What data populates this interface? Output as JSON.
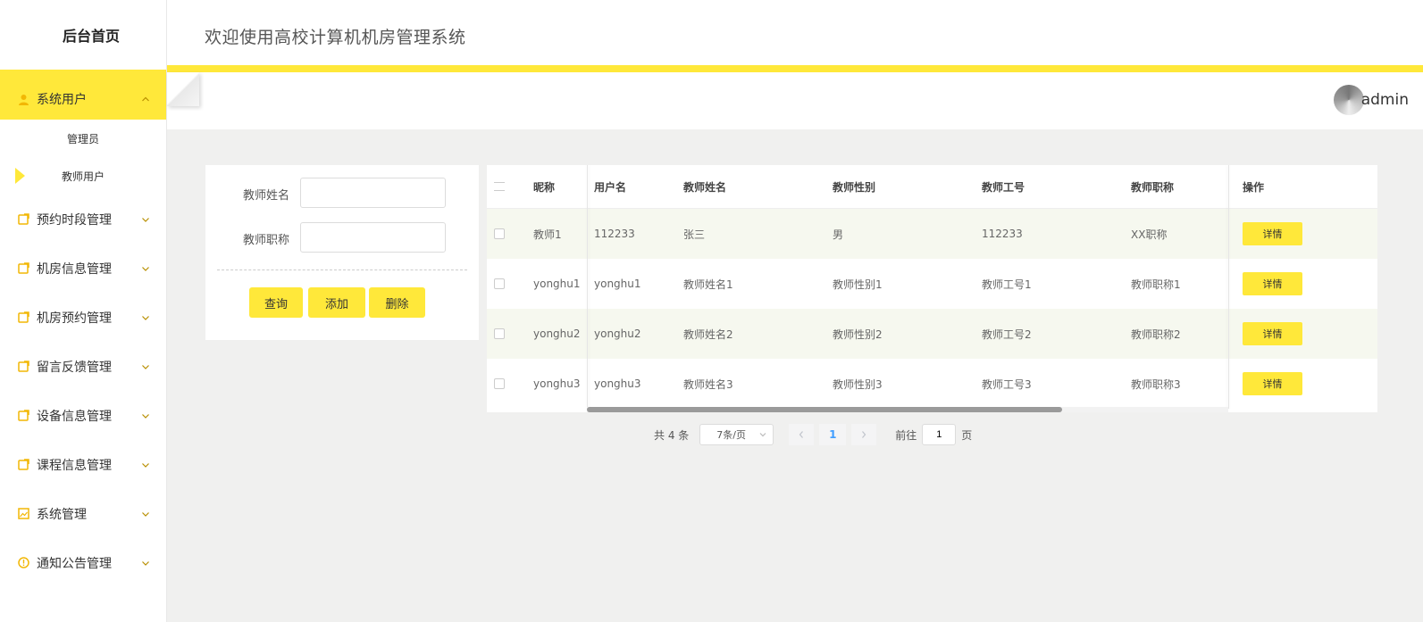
{
  "sidebar": {
    "brand": "后台首页",
    "active_menu": {
      "label": "系统用户",
      "icon": "user-icon"
    },
    "submenu": [
      {
        "label": "管理员"
      },
      {
        "label": "教师用户"
      }
    ],
    "menus": [
      {
        "label": "预约时段管理",
        "icon": "edit-icon"
      },
      {
        "label": "机房信息管理",
        "icon": "edit-icon"
      },
      {
        "label": "机房预约管理",
        "icon": "edit-icon"
      },
      {
        "label": "留言反馈管理",
        "icon": "edit-icon"
      },
      {
        "label": "设备信息管理",
        "icon": "edit-icon"
      },
      {
        "label": "课程信息管理",
        "icon": "edit-icon"
      },
      {
        "label": "系统管理",
        "icon": "image-icon"
      },
      {
        "label": "通知公告管理",
        "icon": "info-circle-icon"
      }
    ]
  },
  "header": {
    "title": "欢迎使用高校计算机机房管理系统",
    "username": "admin"
  },
  "search": {
    "name_label": "教师姓名",
    "name_value": "",
    "title_label": "教师职称",
    "title_value": "",
    "query_label": "查询",
    "add_label": "添加",
    "delete_label": "删除"
  },
  "table": {
    "headers": [
      "昵称",
      "用户名",
      "教师姓名",
      "教师性别",
      "教师工号",
      "教师职称",
      "操作"
    ],
    "rows": [
      [
        "教师1",
        "112233",
        "张三",
        "男",
        "112233",
        "XX职称"
      ],
      [
        "yonghu1",
        "yonghu1",
        "教师姓名1",
        "教师性别1",
        "教师工号1",
        "教师职称1"
      ],
      [
        "yonghu2",
        "yonghu2",
        "教师姓名2",
        "教师性别2",
        "教师工号2",
        "教师职称2"
      ],
      [
        "yonghu3",
        "yonghu3",
        "教师姓名3",
        "教师性别3",
        "教师工号3",
        "教师职称3"
      ]
    ],
    "detail_label": "详情"
  },
  "pagination": {
    "total": "共 4 条",
    "page_size": "7条/页",
    "current_page": "1",
    "goto_prefix": "前往",
    "goto_value": "1",
    "goto_suffix": "页"
  },
  "colors": {
    "accent": "#ffe83a",
    "content_bg": "#f0f0ef"
  }
}
